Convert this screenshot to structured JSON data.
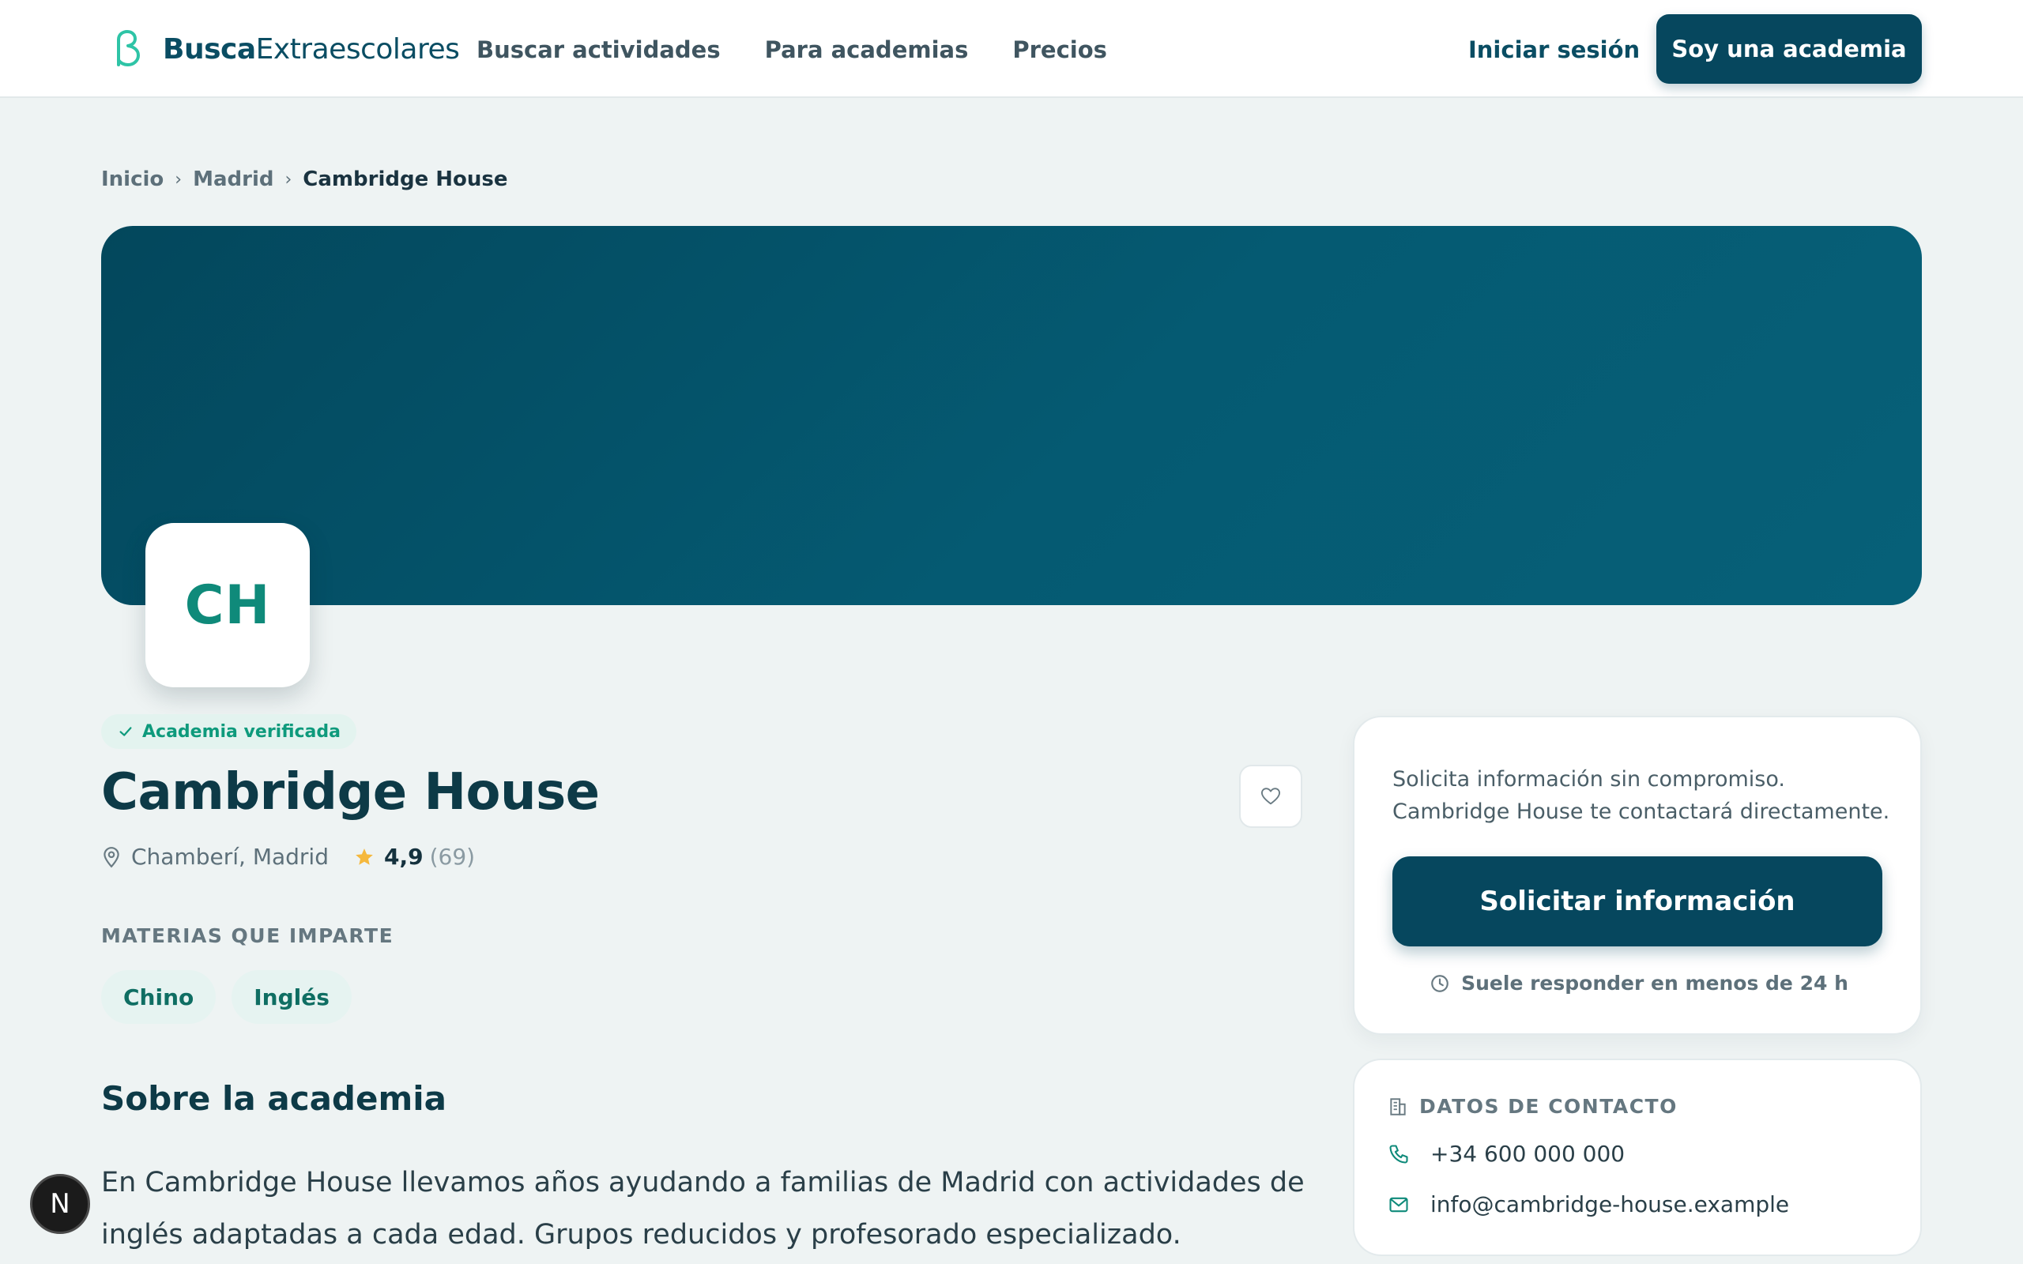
{
  "header": {
    "brand_bold": "Busca",
    "brand_regular": "Extraescolares",
    "nav": [
      "Buscar actividades",
      "Para academias",
      "Precios"
    ],
    "login": "Iniciar sesión",
    "cta": "Soy una academia"
  },
  "breadcrumb": [
    "Inicio",
    "Madrid",
    "Cambridge House"
  ],
  "academy": {
    "initials": "CH",
    "verified": "Academia verificada",
    "name": "Cambridge House",
    "location": "Chamberí, Madrid",
    "rating": "4,9",
    "reviews": "(69)",
    "subjects_label": "MATERIAS QUE IMPARTE",
    "subjects": [
      "Chino",
      "Inglés"
    ],
    "about_title": "Sobre la academia",
    "about_text": "En Cambridge House llevamos años ayudando a familias de Madrid con actividades de inglés adaptadas a cada edad. Grupos reducidos y profesorado especializado."
  },
  "request_card": {
    "text": "Solicita información sin compromiso. Cambridge House te contactará directamente.",
    "button": "Solicitar información",
    "note": "Suele responder en menos de 24 h"
  },
  "contact": {
    "title": "DATOS DE CONTACTO",
    "phone": "+34 600 000 000",
    "email": "info@cambridge-house.example"
  },
  "badge": "N",
  "colors": {
    "primary": "#06475e",
    "accent": "#0f8a7a",
    "background": "#eef3f3"
  }
}
